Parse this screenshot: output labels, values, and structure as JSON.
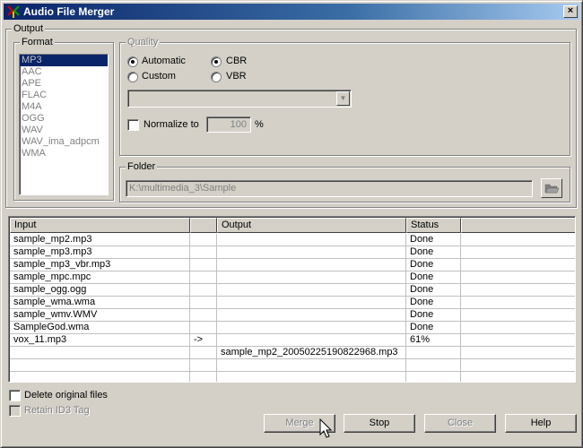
{
  "window": {
    "title": "Audio File Merger",
    "icon": "app-merge-icon",
    "close_glyph": "×"
  },
  "output_group": {
    "label": "Output"
  },
  "format": {
    "label": "Format",
    "items": [
      "MP3",
      "AAC",
      "APE",
      "FLAC",
      "M4A",
      "OGG",
      "WAV",
      "WAV_ima_adpcm",
      "WMA"
    ],
    "selected_index": 0
  },
  "quality": {
    "label": "Quality",
    "automatic": "Automatic",
    "custom": "Custom",
    "cbr": "CBR",
    "vbr": "VBR",
    "mode_selected": "Automatic",
    "bitrate_selected": "CBR",
    "combo_value": "",
    "normalize_label": "Normalize to",
    "normalize_value": "100",
    "normalize_unit": "%",
    "normalize_checked": false
  },
  "folder": {
    "label": "Folder",
    "path": "K:\\multimedia_3\\Sample",
    "browse_icon": "folder-open-icon"
  },
  "table": {
    "columns": [
      "Input",
      "",
      "Output",
      "Status",
      ""
    ],
    "rows": [
      {
        "input": "sample_mp2.mp3",
        "arrow": "",
        "output": "",
        "status": "Done"
      },
      {
        "input": "sample_mp3.mp3",
        "arrow": "",
        "output": "",
        "status": "Done"
      },
      {
        "input": "sample_mp3_vbr.mp3",
        "arrow": "",
        "output": "",
        "status": "Done"
      },
      {
        "input": "sample_mpc.mpc",
        "arrow": "",
        "output": "",
        "status": "Done"
      },
      {
        "input": "sample_ogg.ogg",
        "arrow": "",
        "output": "",
        "status": "Done"
      },
      {
        "input": "sample_wma.wma",
        "arrow": "",
        "output": "",
        "status": "Done"
      },
      {
        "input": "sample_wmv.WMV",
        "arrow": "",
        "output": "",
        "status": "Done"
      },
      {
        "input": "SampleGod.wma",
        "arrow": "",
        "output": "",
        "status": "Done"
      },
      {
        "input": "vox_11.mp3",
        "arrow": "->",
        "output": "",
        "status": "61%"
      },
      {
        "input": "",
        "arrow": "",
        "output": "sample_mp2_20050225190822968.mp3",
        "status": ""
      },
      {
        "input": "",
        "arrow": "",
        "output": "",
        "status": ""
      },
      {
        "input": "",
        "arrow": "",
        "output": "",
        "status": ""
      }
    ]
  },
  "options": {
    "delete_original": "Delete original files",
    "retain_id3": "Retain ID3 Tag"
  },
  "buttons": {
    "merge": "Merge",
    "stop": "Stop",
    "close": "Close",
    "help": "Help"
  },
  "colors": {
    "title_start": "#0a246a",
    "title_end": "#a6caf0",
    "selection": "#0a246a",
    "face": "#d4d0c8"
  }
}
